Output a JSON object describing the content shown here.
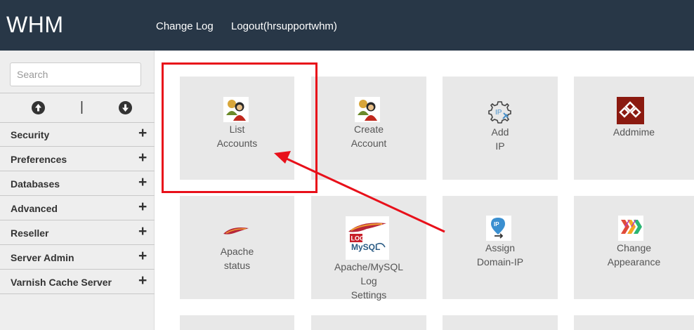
{
  "header": {
    "brand": "WHM",
    "links": {
      "change_log": "Change Log",
      "logout": "Logout(hrsupportwhm)"
    }
  },
  "sidebar": {
    "search": {
      "placeholder": "Search",
      "value": ""
    },
    "expand_controls": {
      "separator": "|",
      "up_icon": "circle-arrow-up-icon",
      "down_icon": "circle-arrow-down-icon"
    },
    "items": [
      {
        "label": "Security",
        "toggle": "+"
      },
      {
        "label": "Preferences",
        "toggle": "+"
      },
      {
        "label": "Databases",
        "toggle": "+"
      },
      {
        "label": "Advanced",
        "toggle": "+"
      },
      {
        "label": "Reseller",
        "toggle": "+"
      },
      {
        "label": "Server Admin",
        "toggle": "+"
      },
      {
        "label": "Varnish Cache Server",
        "toggle": "+"
      }
    ]
  },
  "tiles": [
    {
      "lines": [
        "List",
        "Accounts"
      ],
      "icon": "users-icon"
    },
    {
      "lines": [
        "Create",
        "Account"
      ],
      "icon": "users-icon"
    },
    {
      "lines": [
        "Add",
        "IP"
      ],
      "icon": "ip-gear-icon"
    },
    {
      "lines": [
        "Addmime"
      ],
      "icon": "addmime-icon"
    },
    {
      "lines": [
        "Apache",
        "status"
      ],
      "icon": "apache-feather-icon"
    },
    {
      "lines": [
        "Apache/MySQL",
        "Log",
        "Settings"
      ],
      "icon": "log-mysql-icon",
      "icon_text": {
        "log": "LOG",
        "mysql": "MySQL"
      }
    },
    {
      "lines": [
        "Assign",
        "Domain-IP"
      ],
      "icon": "ip-pin-icon"
    },
    {
      "lines": [
        "Change",
        "Appearance"
      ],
      "icon": "appearance-icon"
    }
  ],
  "colors": {
    "topbar": "#283747",
    "sidebar": "#eeeeee",
    "tile": "#e8e8e8",
    "annotation": "#e8101a"
  }
}
